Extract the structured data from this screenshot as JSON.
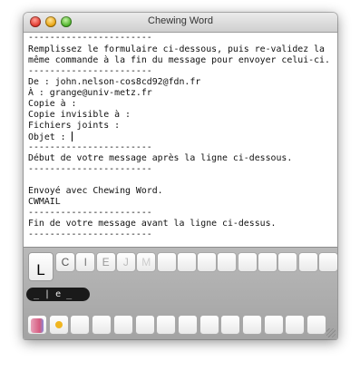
{
  "window": {
    "title": "Chewing Word"
  },
  "editor": {
    "lines": [
      "-----------------------",
      "Remplissez le formulaire ci-dessous, puis re-validez la",
      "même commande à la fin du message pour envoyer celui-ci.",
      "-----------------------",
      "De : john.nelson-cos8cd92@fdn.fr",
      "À : grange@univ-metz.fr",
      "Copie à :",
      "Copie invisible à :",
      "Fichiers joints :",
      "Objet : ",
      "-----------------------",
      "Début de votre message après la ligne ci-dessous.",
      "-----------------------",
      "",
      "Envoyé avec Chewing Word.",
      "CWMAIL",
      "-----------------------",
      "Fin de votre message avant la ligne ci-dessus.",
      "-----------------------"
    ]
  },
  "keyboard": {
    "big_key": "L",
    "keys": [
      "C",
      "I",
      "E",
      "J",
      "M",
      "",
      "",
      "",
      "",
      "",
      "",
      "",
      "",
      ""
    ],
    "word_suggestion": "_ | e _",
    "color_keys": [
      "pink-swatch",
      "yellow-dot",
      "",
      "",
      "",
      "",
      "",
      "",
      "",
      "",
      "",
      "",
      "",
      ""
    ]
  },
  "colors": {
    "window_bg": "#ffffff",
    "panel_bg": "#b0b0b0"
  }
}
